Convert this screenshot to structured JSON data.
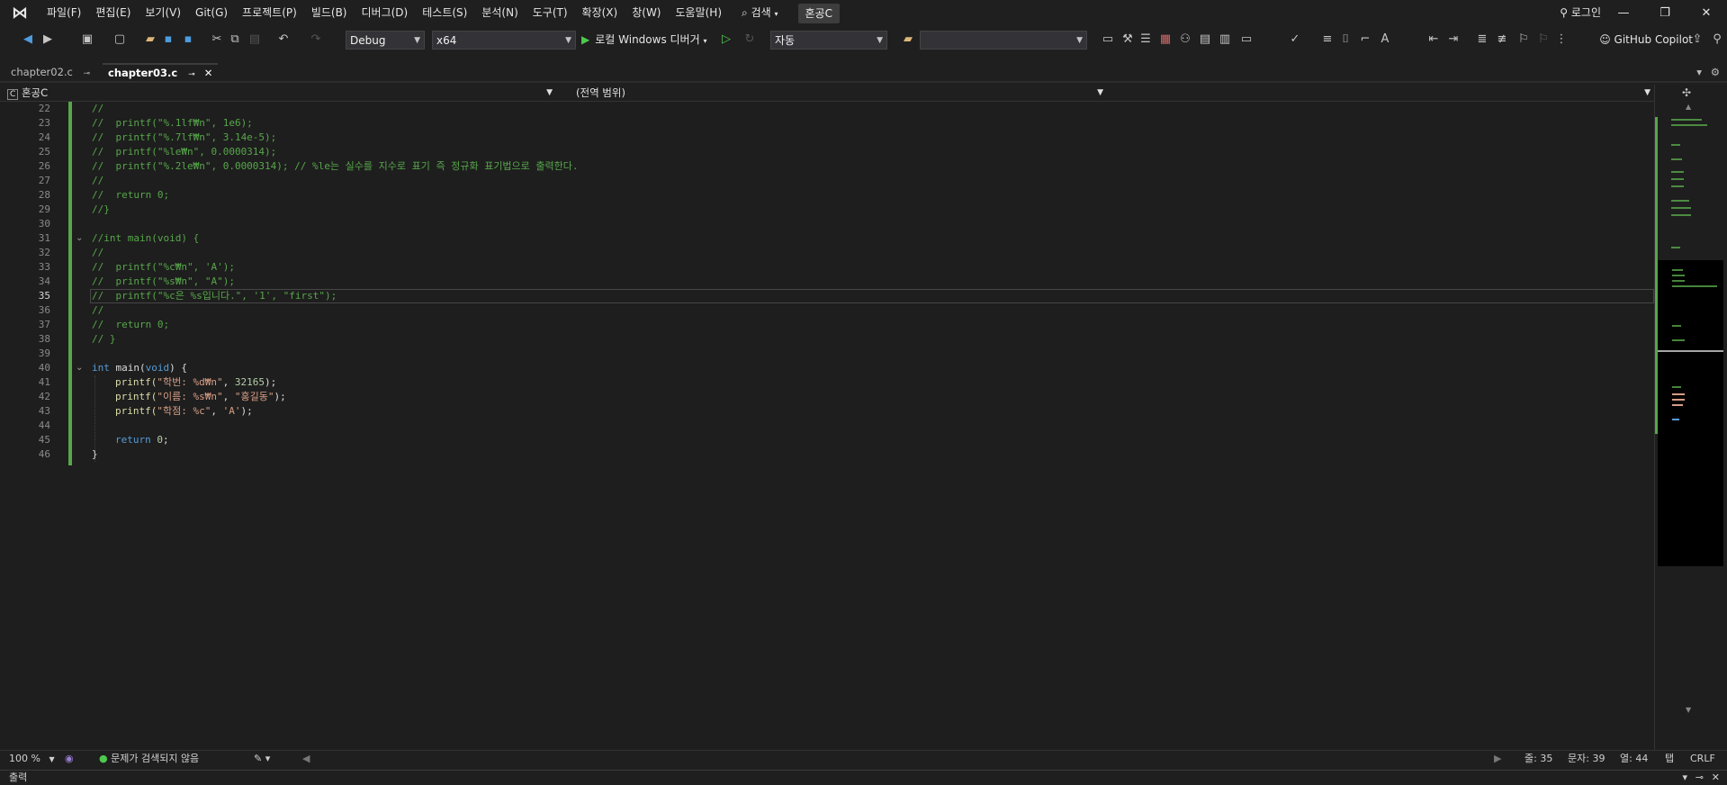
{
  "menubar": {
    "items": [
      "파일(F)",
      "편집(E)",
      "보기(V)",
      "Git(G)",
      "프로젝트(P)",
      "빌드(B)",
      "디버그(D)",
      "테스트(S)",
      "분석(N)",
      "도구(T)",
      "확장(X)",
      "창(W)",
      "도움말(H)"
    ],
    "search_label": "검색",
    "solution_name": "혼공C",
    "login_label": "로그인"
  },
  "toolbar": {
    "config": "Debug",
    "platform": "x64",
    "run_label": "로컬 Windows 디버거",
    "mode": "자동",
    "copilot_label": "GitHub Copilot"
  },
  "tabs": [
    {
      "label": "chapter02.c",
      "active": false
    },
    {
      "label": "chapter03.c",
      "active": true
    }
  ],
  "navbar": {
    "project": "혼공C",
    "scope": "(전역 범위)"
  },
  "editor": {
    "lines": [
      {
        "n": "22",
        "t": "//"
      },
      {
        "n": "23",
        "t": "//  printf(\"%.1lf₩n\", 1e6);"
      },
      {
        "n": "24",
        "t": "//  printf(\"%.7lf₩n\", 3.14e-5);"
      },
      {
        "n": "25",
        "t": "//  printf(\"%le₩n\", 0.0000314);"
      },
      {
        "n": "26",
        "t": "//  printf(\"%.2le₩n\", 0.0000314); // %le는 실수를 지수로 표기 즉 정규화 표기법으로 출력한다."
      },
      {
        "n": "27",
        "t": "//"
      },
      {
        "n": "28",
        "t": "//  return 0;"
      },
      {
        "n": "29",
        "t": "//}"
      },
      {
        "n": "30",
        "t": ""
      },
      {
        "n": "31",
        "t": "//int main(void) {"
      },
      {
        "n": "32",
        "t": "//"
      },
      {
        "n": "33",
        "t": "//  printf(\"%c₩n\", 'A');"
      },
      {
        "n": "34",
        "t": "//  printf(\"%s₩n\", \"A\");"
      },
      {
        "n": "35",
        "t": "//  printf(\"%c은 %s입니다.\", '1', \"first\");"
      },
      {
        "n": "36",
        "t": "//"
      },
      {
        "n": "37",
        "t": "//  return 0;"
      },
      {
        "n": "38",
        "t": "// }"
      },
      {
        "n": "39",
        "t": ""
      },
      {
        "n": "40",
        "t": ""
      },
      {
        "n": "41",
        "t": ""
      },
      {
        "n": "42",
        "t": ""
      },
      {
        "n": "43",
        "t": ""
      },
      {
        "n": "44",
        "t": ""
      },
      {
        "n": "45",
        "t": ""
      },
      {
        "n": "46",
        "t": "}"
      }
    ],
    "main_code": {
      "l40_kw": "int",
      "l40_rest": " main(",
      "l40_void": "void",
      "l40_end": ") {",
      "l41_fn": "printf(",
      "l41_str": "\"학번: %d₩n\"",
      "l41_sep": ", ",
      "l41_num": "32165",
      "l41_end": ");",
      "l42_fn": "printf(",
      "l42_str": "\"이름: %s₩n\"",
      "l42_sep": ", ",
      "l42_str2": "\"홍길동\"",
      "l42_end": ");",
      "l43_fn": "printf(",
      "l43_str": "\"학점: %c\"",
      "l43_sep": ", ",
      "l43_str2": "'A'",
      "l43_end": ");",
      "l45_kw": "return",
      "l45_num": " 0",
      "l45_end": ";"
    },
    "current_line": "35"
  },
  "statusbar": {
    "zoom": "100 %",
    "issues": "문제가 검색되지 않음",
    "line": "줄: 35",
    "char": "문자: 39",
    "col": "열: 44",
    "tab": "탭",
    "eol": "CRLF"
  },
  "output_panel": {
    "title": "출력"
  },
  "colors": {
    "accent": "#57a64a",
    "keyword": "#569cd6",
    "string": "#d69d85",
    "comment": "#57a64a"
  }
}
